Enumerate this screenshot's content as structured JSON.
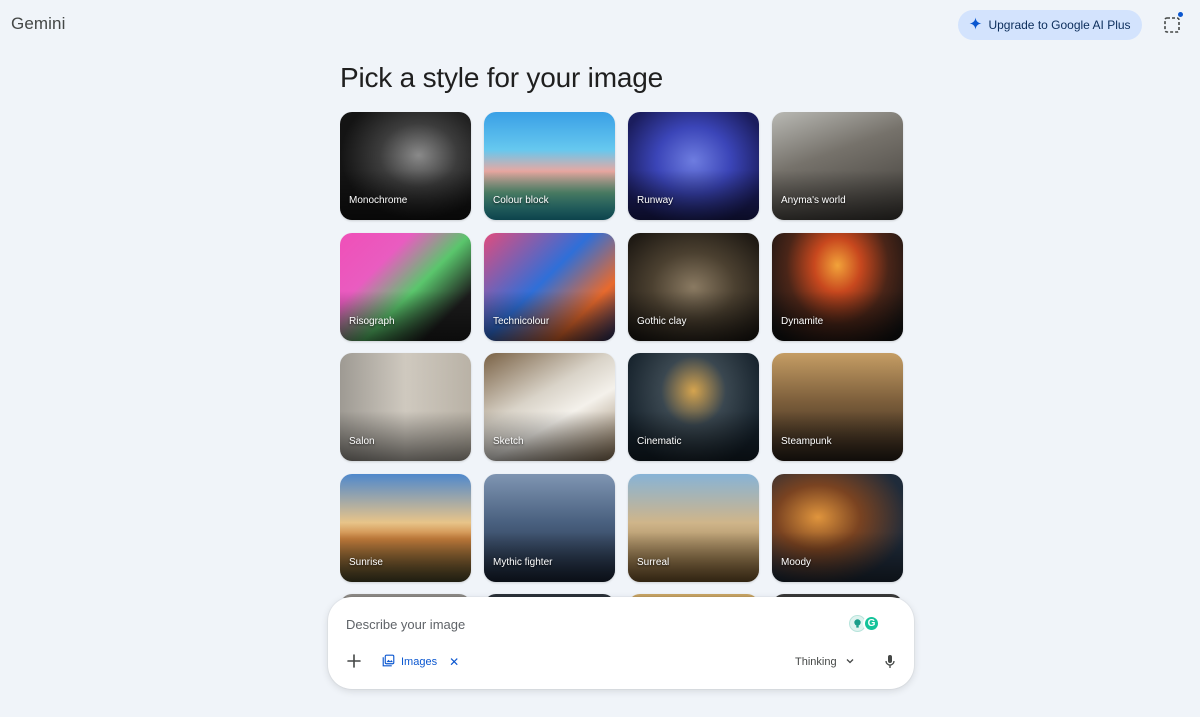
{
  "app": {
    "name": "Gemini"
  },
  "header": {
    "upgrade_label": "Upgrade to Google AI Plus"
  },
  "main": {
    "title": "Pick a style for your image",
    "styles": [
      {
        "label": "Monochrome"
      },
      {
        "label": "Colour block"
      },
      {
        "label": "Runway"
      },
      {
        "label": "Anyma's world"
      },
      {
        "label": "Risograph"
      },
      {
        "label": "Technicolour"
      },
      {
        "label": "Gothic clay"
      },
      {
        "label": "Dynamite"
      },
      {
        "label": "Salon"
      },
      {
        "label": "Sketch"
      },
      {
        "label": "Cinematic"
      },
      {
        "label": "Steampunk"
      },
      {
        "label": "Sunrise"
      },
      {
        "label": "Mythic fighter"
      },
      {
        "label": "Surreal"
      },
      {
        "label": "Moody"
      }
    ]
  },
  "prompt": {
    "placeholder": "Describe your image",
    "tool_chip_label": "Images",
    "mode_label": "Thinking"
  },
  "icons": {
    "upgrade": "sparkle-icon",
    "corner": "dashed-square-icon",
    "plus": "plus-icon",
    "tool": "image-gallery-icon",
    "close": "close-icon",
    "mode": "chevron-down-icon",
    "mic": "microphone-icon"
  },
  "colors": {
    "background": "#f0f4f9",
    "accent": "#0b57d0",
    "upgrade_bg": "#d3e3fd"
  }
}
